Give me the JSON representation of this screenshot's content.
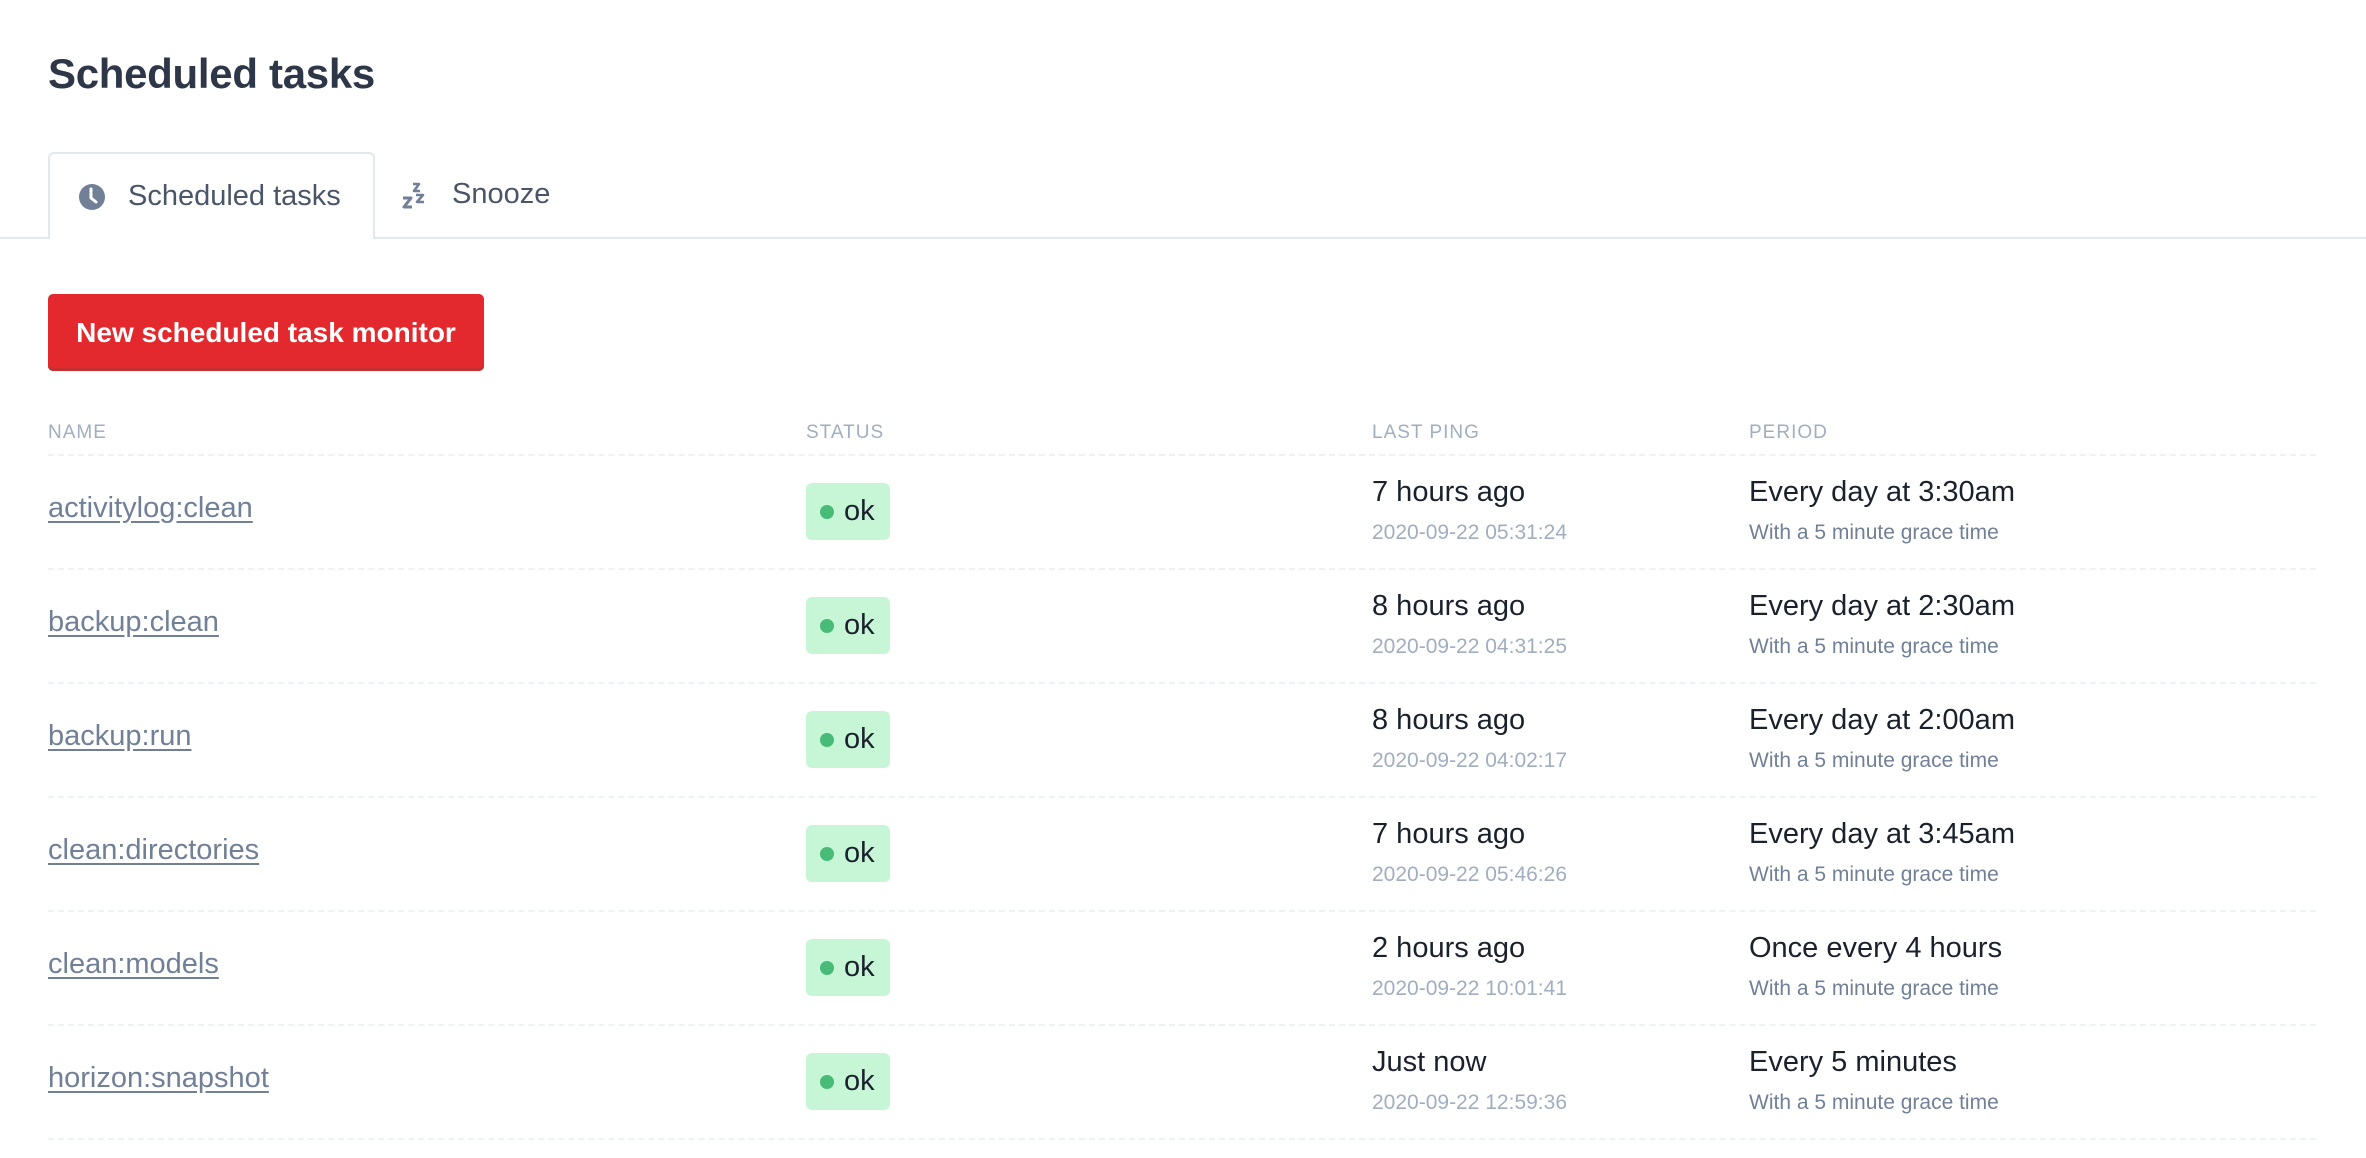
{
  "page": {
    "title": "Scheduled tasks"
  },
  "tabs": [
    {
      "label": "Scheduled tasks",
      "icon": "clock-icon",
      "active": true
    },
    {
      "label": "Snooze",
      "icon": "snooze-icon",
      "active": false
    }
  ],
  "toolbar": {
    "new_monitor_label": "New scheduled task monitor"
  },
  "colors": {
    "accent": "#e3292d",
    "ok_badge_bg": "#c6f6d5",
    "ok_dot": "#48bb78",
    "title": "#2d3748",
    "muted": "#a0aec0"
  },
  "table": {
    "headers": {
      "name": "Name",
      "status": "Status",
      "last_ping": "Last ping",
      "period": "Period"
    },
    "rows": [
      {
        "name": "activitylog:clean",
        "status": "ok",
        "last_ping": "7 hours ago",
        "last_ping_time": "2020-09-22 05:31:24",
        "period": "Every day at 3:30am",
        "grace": "With a 5 minute grace time"
      },
      {
        "name": "backup:clean",
        "status": "ok",
        "last_ping": "8 hours ago",
        "last_ping_time": "2020-09-22 04:31:25",
        "period": "Every day at 2:30am",
        "grace": "With a 5 minute grace time"
      },
      {
        "name": "backup:run",
        "status": "ok",
        "last_ping": "8 hours ago",
        "last_ping_time": "2020-09-22 04:02:17",
        "period": "Every day at 2:00am",
        "grace": "With a 5 minute grace time"
      },
      {
        "name": "clean:directories",
        "status": "ok",
        "last_ping": "7 hours ago",
        "last_ping_time": "2020-09-22 05:46:26",
        "period": "Every day at 3:45am",
        "grace": "With a 5 minute grace time"
      },
      {
        "name": "clean:models",
        "status": "ok",
        "last_ping": "2 hours ago",
        "last_ping_time": "2020-09-22 10:01:41",
        "period": "Once every 4 hours",
        "grace": "With a 5 minute grace time"
      },
      {
        "name": "horizon:snapshot",
        "status": "ok",
        "last_ping": "Just now",
        "last_ping_time": "2020-09-22 12:59:36",
        "period": "Every 5 minutes",
        "grace": "With a 5 minute grace time"
      }
    ]
  }
}
